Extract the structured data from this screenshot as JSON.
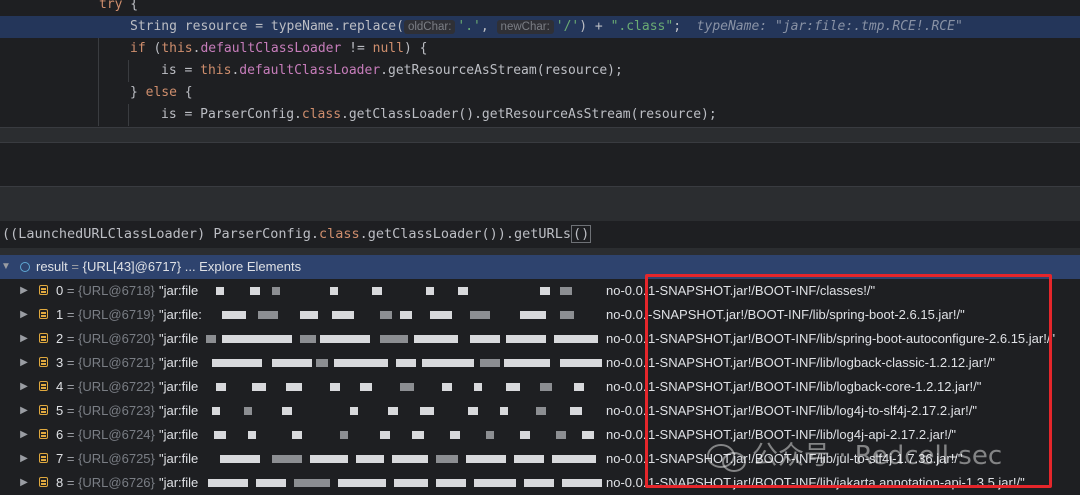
{
  "editor": {
    "lines": [
      {
        "kw": "try",
        "rest": " {"
      },
      {
        "pre": "String resource = typeName.replace(",
        "hint1": "oldChar:",
        "lit1": "'.'",
        "mid": ", ",
        "hint2": "newChar:",
        "lit2": "'/'",
        "post": ") + ",
        "lit3": "\".class\"",
        "tail": ";",
        "inline": "typeName: \"jar:file:.tmp.RCE!.RCE\""
      },
      {
        "kw": "if",
        "p1": " (",
        "kw2": "this",
        "p2": ".",
        "fld": "defaultClassLoader",
        "p3": " != ",
        "kw3": "null",
        "p4": ") {"
      },
      {
        "pre": "is = ",
        "kw": "this",
        "p1": ".",
        "fld": "defaultClassLoader",
        "p2": ".getResourceAsStream(resource);"
      },
      {
        "pre": "} ",
        "kw": "else",
        "post": " {"
      },
      {
        "pre": "is = ParserConfig.",
        "kw": "class",
        "post": ".getClassLoader().getResourceAsStream(resource);"
      }
    ]
  },
  "expression": {
    "pre": "((LaunchedURLClassLoader) ParserConfig.",
    "kw": "class",
    "mid": ".getClassLoader()).getURLs",
    "paren": "()"
  },
  "result": {
    "name": "result",
    "eq": " = ",
    "value": "{URL[43]@6717}",
    "link": " ... Explore Elements"
  },
  "items": [
    {
      "index": "0",
      "obj": "{URL@6718}",
      "start": "\"jar:file",
      "mid": "no-0.0.",
      "tail": "1-SNAPSHOT.jar!/BOOT-INF/classes!/\""
    },
    {
      "index": "1",
      "obj": "{URL@6719}",
      "start": "\"jar:file:",
      "mid": "no-0.0.",
      "tail": "-SNAPSHOT.jar!/BOOT-INF/lib/spring-boot-2.6.15.jar!/\""
    },
    {
      "index": "2",
      "obj": "{URL@6720}",
      "start": "\"jar:file",
      "mid": "no-0.0.",
      "tail": "1-SNAPSHOT.jar!/BOOT-INF/lib/spring-boot-autoconfigure-2.6.15.jar!/\""
    },
    {
      "index": "3",
      "obj": "{URL@6721}",
      "start": "\"jar:file",
      "mid": "no-0.0.",
      "tail": "1-SNAPSHOT.jar!/BOOT-INF/lib/logback-classic-1.2.12.jar!/\""
    },
    {
      "index": "4",
      "obj": "{URL@6722}",
      "start": "\"jar:file",
      "mid": "no-0.0.",
      "tail": "1-SNAPSHOT.jar!/BOOT-INF/lib/logback-core-1.2.12.jar!/\""
    },
    {
      "index": "5",
      "obj": "{URL@6723}",
      "start": "\"jar:file",
      "mid": "no-0.0.",
      "tail": "1-SNAPSHOT.jar!/BOOT-INF/lib/log4j-to-slf4j-2.17.2.jar!/\""
    },
    {
      "index": "6",
      "obj": "{URL@6724}",
      "start": "\"jar:file",
      "mid": "no-0.0.",
      "tail": "1-SNAPSHOT.jar!/BOOT-INF/lib/log4j-api-2.17.2.jar!/\""
    },
    {
      "index": "7",
      "obj": "{URL@6725}",
      "start": "\"jar:file",
      "mid": "no-0.0.",
      "tail": "1-SNAPSHOT.jar!/BOOT-INF/lib/jul-to-slf4j-1.7.36.jar!/\""
    },
    {
      "index": "8",
      "obj": "{URL@6726}",
      "start": "\"jar:file",
      "mid": "no-0.0.",
      "tail": "1-SNAPSHOT.jar!/BOOT-INF/lib/jakarta.annotation-api-1.3.5.jar!/\""
    }
  ],
  "watermark": {
    "text": "公众号 · Redcell-sec"
  },
  "colors": {
    "highlight": "#24365a",
    "selected_row": "#2e436e",
    "redbox": "#e5262b",
    "keyword": "#cf8e6d",
    "field": "#c77dbb",
    "string": "#6aab73"
  }
}
